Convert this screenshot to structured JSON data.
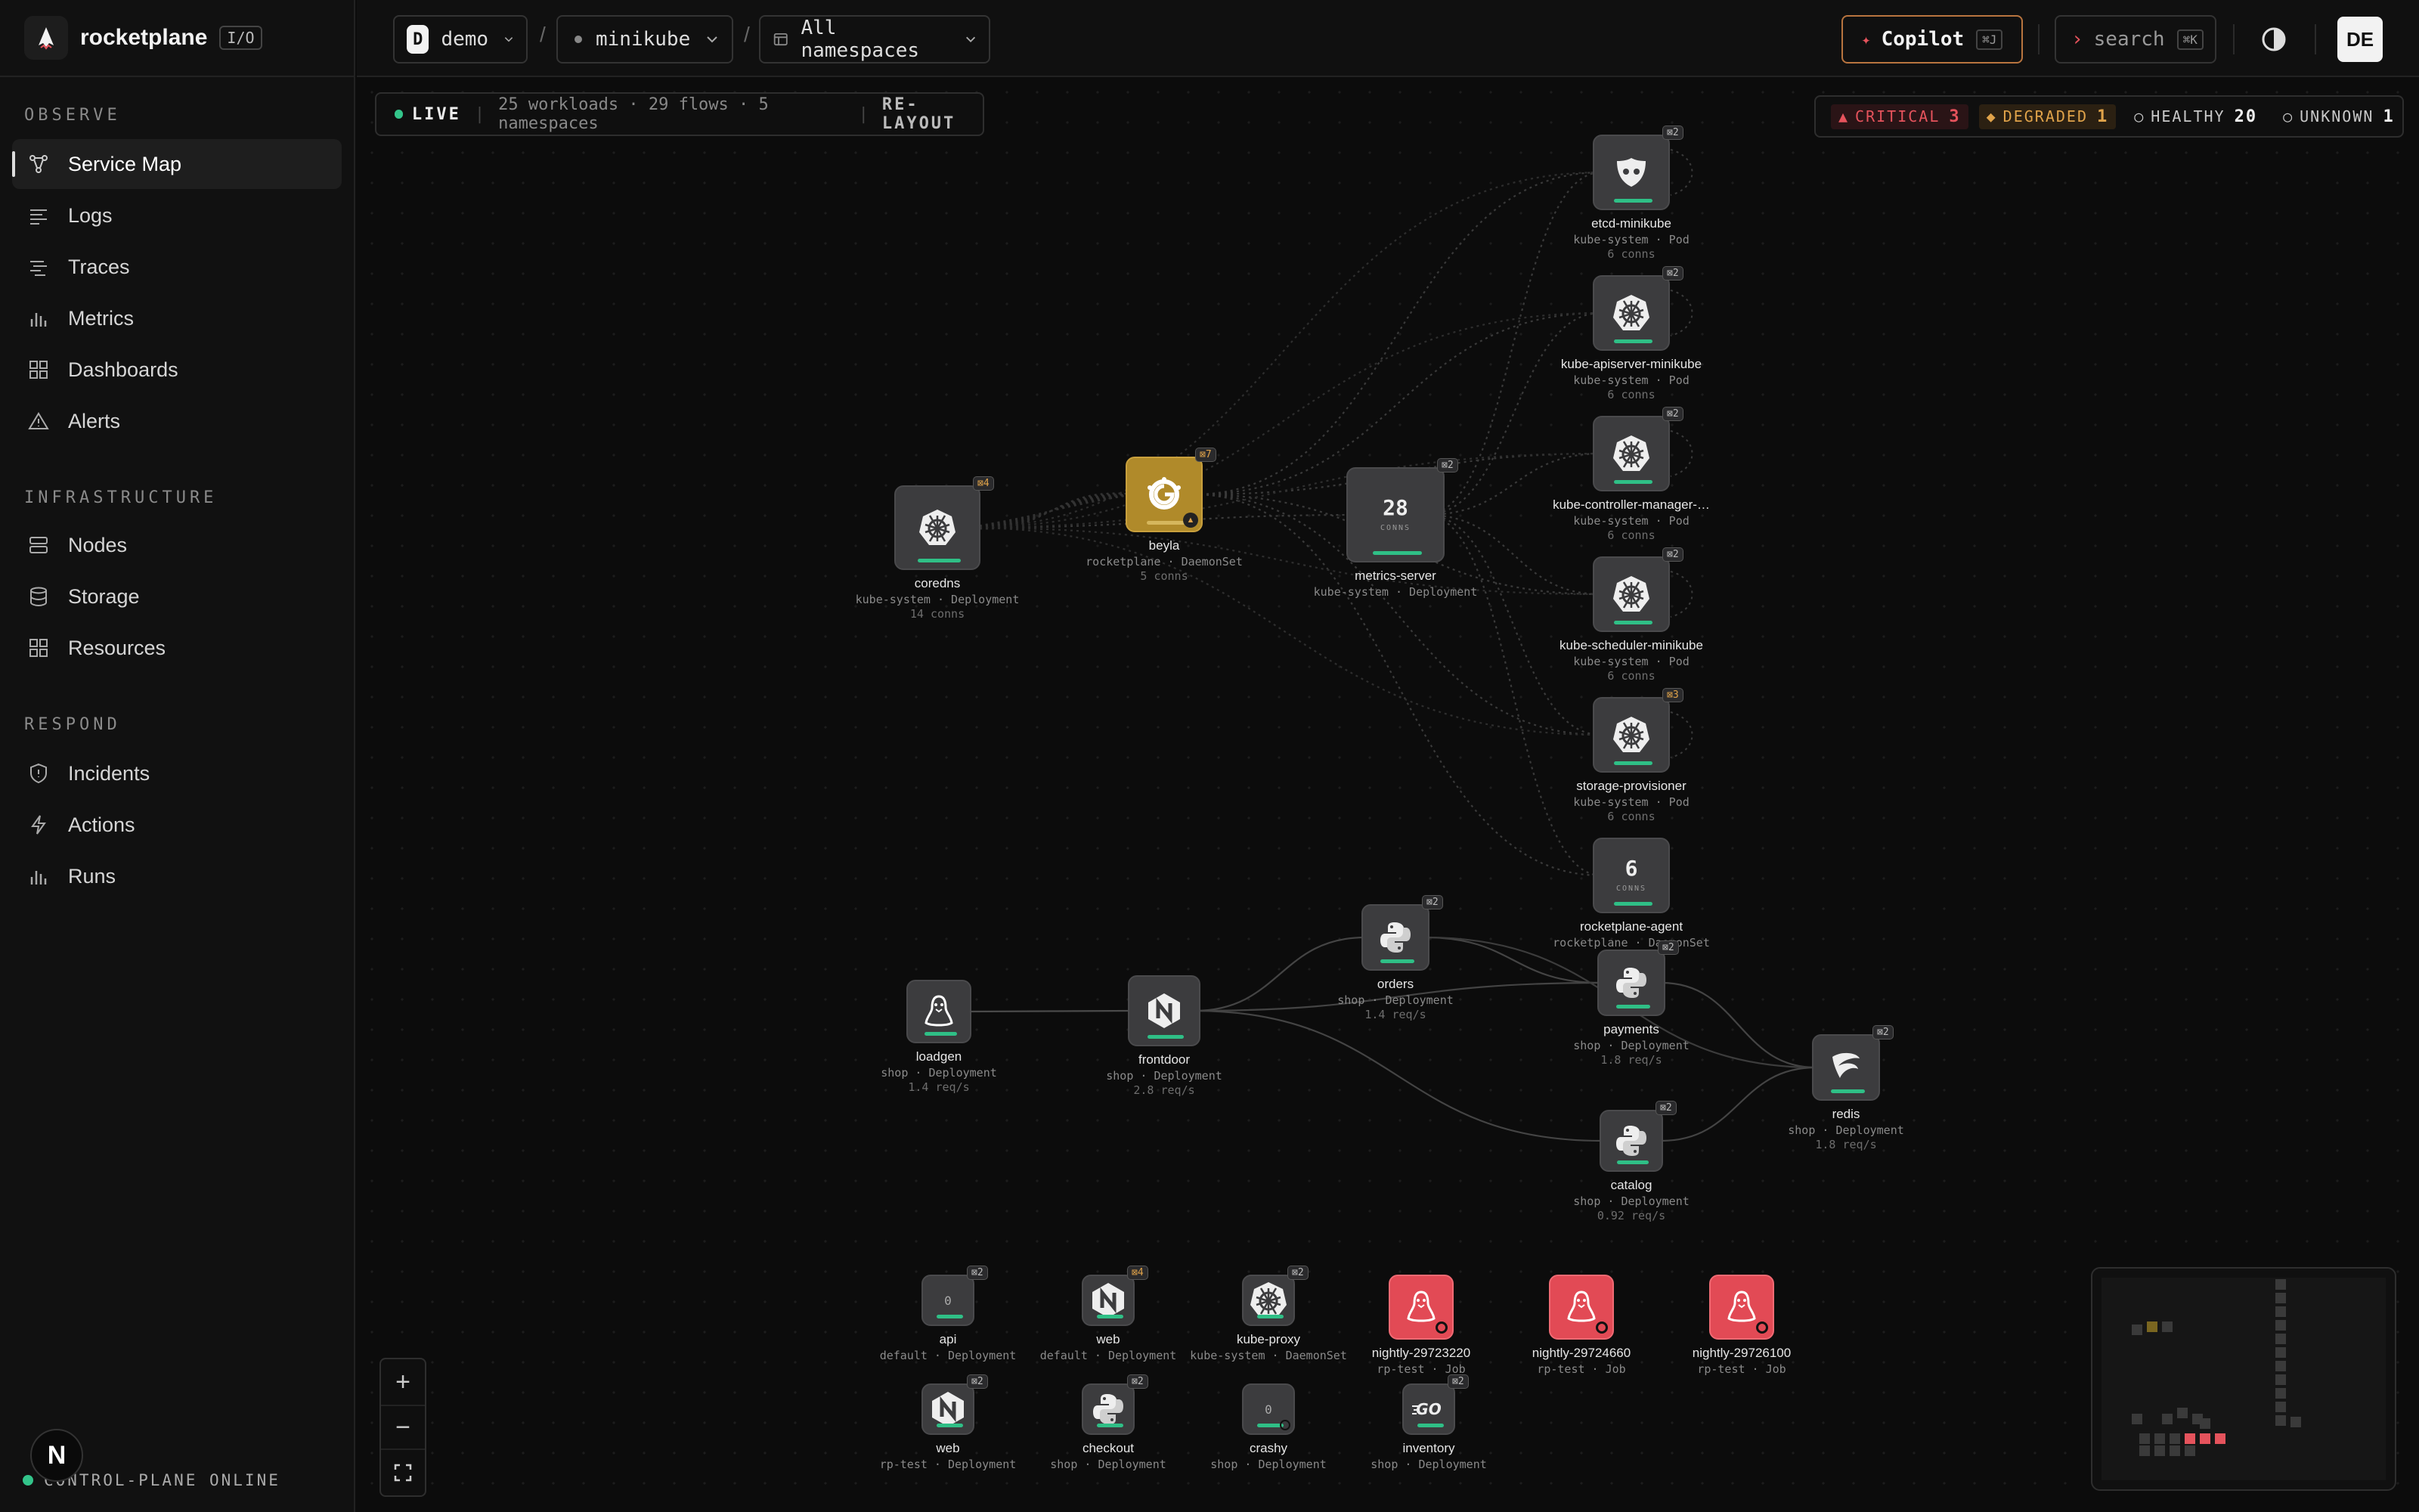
{
  "brand": {
    "name": "rocketplane",
    "tag": "I/O"
  },
  "sidebar": {
    "sections": [
      {
        "title": "OBSERVE",
        "items": [
          {
            "label": "Service Map",
            "icon": "service-map-icon",
            "active": true
          },
          {
            "label": "Logs",
            "icon": "logs-icon"
          },
          {
            "label": "Traces",
            "icon": "traces-icon"
          },
          {
            "label": "Metrics",
            "icon": "metrics-icon"
          },
          {
            "label": "Dashboards",
            "icon": "dashboards-icon"
          },
          {
            "label": "Alerts",
            "icon": "alert-triangle-icon"
          }
        ]
      },
      {
        "title": "INFRASTRUCTURE",
        "items": [
          {
            "label": "Nodes",
            "icon": "nodes-icon"
          },
          {
            "label": "Storage",
            "icon": "database-icon"
          },
          {
            "label": "Resources",
            "icon": "resources-icon"
          }
        ]
      },
      {
        "title": "RESPOND",
        "items": [
          {
            "label": "Incidents",
            "icon": "shield-icon"
          },
          {
            "label": "Actions",
            "icon": "bolt-icon"
          },
          {
            "label": "Runs",
            "icon": "runs-icon"
          }
        ]
      }
    ],
    "status": "CONTROL-PLANE ONLINE",
    "fab": "N"
  },
  "topbar": {
    "org": {
      "initial": "D",
      "label": "demo"
    },
    "cluster": "minikube",
    "namespace": "All namespaces",
    "copilot": {
      "label": "Copilot",
      "kbd": "⌘J"
    },
    "search": {
      "label": "search",
      "kbd": "⌘K"
    },
    "avatar": "DE"
  },
  "map": {
    "live": "LIVE",
    "summary": "25 workloads · 29 flows · 5 namespaces",
    "relayout": "RE-LAYOUT",
    "health": [
      {
        "label": "CRITICAL",
        "count": "3",
        "color": "#e5535c",
        "bg": "#2a1416",
        "glyph": "▲"
      },
      {
        "label": "DEGRADED",
        "count": "1",
        "color": "#e0a34a",
        "bg": "#2b2012",
        "glyph": "◆"
      },
      {
        "label": "HEALTHY",
        "count": "20",
        "color": "#c8c8c8",
        "bg": "transparent",
        "glyph": "○"
      },
      {
        "label": "UNKNOWN",
        "count": "1",
        "color": "#c8c8c8",
        "bg": "transparent",
        "glyph": "○"
      }
    ],
    "nodes": [
      {
        "id": "coredns",
        "name": "coredns",
        "sub": "kube-system · Deployment",
        "meta": "14 conns",
        "icon": "k8s",
        "badge": "⊠4"
      },
      {
        "id": "beyla",
        "name": "beyla",
        "sub": "rocketplane · DaemonSet",
        "meta": "5 conns",
        "icon": "grafana",
        "badge": "⊠7"
      },
      {
        "id": "metrics-server",
        "name": "metrics-server",
        "sub": "kube-system · Deployment",
        "meta": "",
        "icon": "count",
        "count": "28",
        "countLabel": "CONNS",
        "badge": "⊠2"
      },
      {
        "id": "etcd",
        "name": "etcd-minikube",
        "sub": "kube-system · Pod",
        "meta": "6 conns",
        "icon": "etcd",
        "badge": "⊠2"
      },
      {
        "id": "apiserver",
        "name": "kube-apiserver-minikube",
        "sub": "kube-system · Pod",
        "meta": "6 conns",
        "icon": "k8s",
        "badge": "⊠2"
      },
      {
        "id": "ctrlmgr",
        "name": "kube-controller-manager-…",
        "sub": "kube-system · Pod",
        "meta": "6 conns",
        "icon": "k8s",
        "badge": "⊠2"
      },
      {
        "id": "scheduler",
        "name": "kube-scheduler-minikube",
        "sub": "kube-system · Pod",
        "meta": "6 conns",
        "icon": "k8s",
        "badge": "⊠2"
      },
      {
        "id": "storage",
        "name": "storage-provisioner",
        "sub": "kube-system · Pod",
        "meta": "6 conns",
        "icon": "k8s",
        "badge": "⊠3"
      },
      {
        "id": "agent",
        "name": "rocketplane-agent",
        "sub": "rocketplane · DaemonSet",
        "meta": "",
        "icon": "count",
        "count": "6",
        "countLabel": "CONNS",
        "badge": ""
      },
      {
        "id": "loadgen",
        "name": "loadgen",
        "sub": "shop · Deployment",
        "meta": "1.4 req/s",
        "icon": "linux",
        "badge": ""
      },
      {
        "id": "frontdoor",
        "name": "frontdoor",
        "sub": "shop · Deployment",
        "meta": "2.8 req/s",
        "icon": "nginx",
        "badge": ""
      },
      {
        "id": "orders",
        "name": "orders",
        "sub": "shop · Deployment",
        "meta": "1.4 req/s",
        "icon": "python",
        "badge": "⊠2"
      },
      {
        "id": "payments",
        "name": "payments",
        "sub": "shop · Deployment",
        "meta": "1.8 req/s",
        "icon": "python",
        "badge": "⊠2"
      },
      {
        "id": "catalog",
        "name": "catalog",
        "sub": "shop · Deployment",
        "meta": "0.92 req/s",
        "icon": "python",
        "badge": "⊠2"
      },
      {
        "id": "redis",
        "name": "redis",
        "sub": "shop · Deployment",
        "meta": "1.8 req/s",
        "icon": "redis",
        "badge": "⊠2"
      },
      {
        "id": "api",
        "name": "api",
        "sub": "default · Deployment",
        "meta": "",
        "icon": "zero",
        "badge": "⊠2"
      },
      {
        "id": "web1",
        "name": "web",
        "sub": "default · Deployment",
        "meta": "",
        "icon": "nginx",
        "badge": "⊠4"
      },
      {
        "id": "kubeproxy",
        "name": "kube-proxy",
        "sub": "kube-system · DaemonSet",
        "meta": "",
        "icon": "k8s",
        "badge": "⊠2"
      },
      {
        "id": "n1",
        "name": "nightly-29723220",
        "sub": "rp-test · Job",
        "meta": "",
        "icon": "linux",
        "badge": ""
      },
      {
        "id": "n2",
        "name": "nightly-29724660",
        "sub": "rp-test · Job",
        "meta": "",
        "icon": "linux",
        "badge": ""
      },
      {
        "id": "n3",
        "name": "nightly-29726100",
        "sub": "rp-test · Job",
        "meta": "",
        "icon": "linux",
        "badge": ""
      },
      {
        "id": "web2",
        "name": "web",
        "sub": "rp-test · Deployment",
        "meta": "",
        "icon": "nginx",
        "badge": "⊠2"
      },
      {
        "id": "checkout",
        "name": "checkout",
        "sub": "shop · Deployment",
        "meta": "",
        "icon": "python",
        "badge": "⊠2"
      },
      {
        "id": "crashy",
        "name": "crashy",
        "sub": "shop · Deployment",
        "meta": "",
        "icon": "zero",
        "badge": ""
      },
      {
        "id": "inventory",
        "name": "inventory",
        "sub": "shop · Deployment",
        "meta": "",
        "icon": "go",
        "badge": "⊠2"
      }
    ]
  }
}
